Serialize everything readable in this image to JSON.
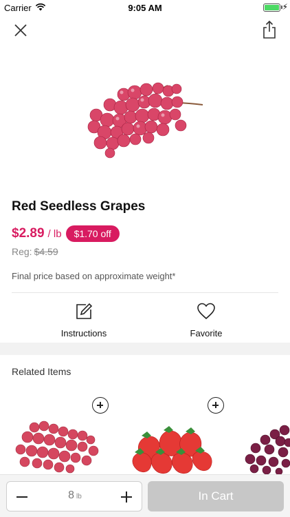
{
  "status_bar": {
    "carrier": "Carrier",
    "time": "9:05 AM",
    "battery_level": 1.0
  },
  "product": {
    "name": "Red Seedless Grapes",
    "price": "$2.89",
    "unit": "/ lb",
    "discount_badge": "$1.70 off",
    "regular_label": "Reg:",
    "regular_price": "$4.59",
    "price_note": "Final price based on approximate weight*"
  },
  "actions": {
    "instructions_label": "Instructions",
    "favorite_label": "Favorite"
  },
  "related": {
    "title": "Related Items",
    "items": [
      {
        "icon": "red-grapes-image"
      },
      {
        "icon": "strawberries-image"
      },
      {
        "icon": "purple-grapes-image"
      }
    ]
  },
  "cart_bar": {
    "quantity": "8",
    "quantity_unit": "lb",
    "button_label": "In Cart"
  },
  "colors": {
    "accent": "#d81b60",
    "disabled_button": "#c7c7c7"
  }
}
